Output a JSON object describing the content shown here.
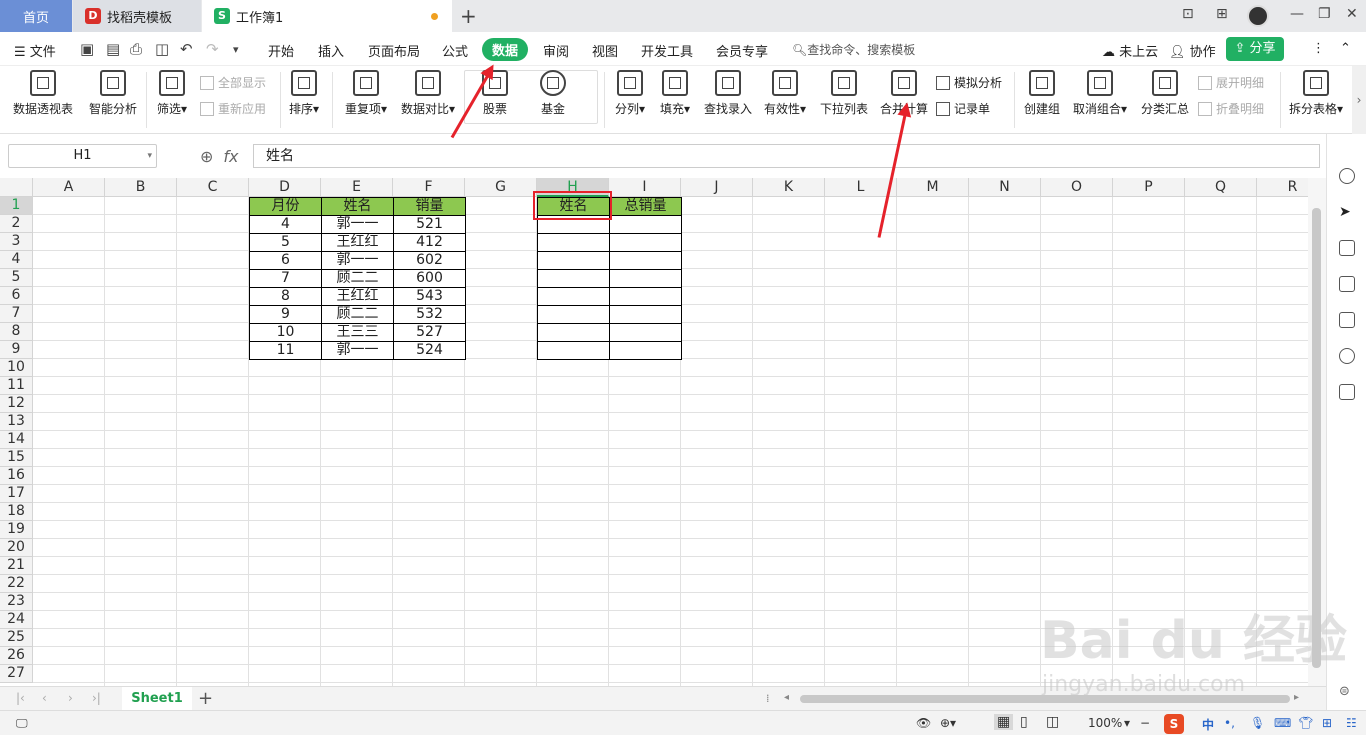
{
  "tabs": {
    "home": "首页",
    "daoke": "找稻壳模板",
    "workbook": "工作簿1"
  },
  "menu": {
    "file": "文件",
    "items": [
      "开始",
      "插入",
      "页面布局",
      "公式",
      "数据",
      "审阅",
      "视图",
      "开发工具",
      "会员专享"
    ],
    "search": "查找命令、搜索模板",
    "cloud": "未上云",
    "collab": "协作",
    "share": "分享"
  },
  "ribbon": {
    "pivot": "数据透视表",
    "smart": "智能分析",
    "filter": "筛选",
    "show_all": "全部显示",
    "reapply": "重新应用",
    "sort": "排序",
    "dup": "重复项",
    "compare": "数据对比",
    "stock": "股票",
    "fund": "基金",
    "split": "分列",
    "fill": "填充",
    "lookup": "查找录入",
    "validity": "有效性",
    "dropdown": "下拉列表",
    "consolidate": "合并计算",
    "simulate": "模拟分析",
    "record": "记录单",
    "group": "创建组",
    "ungroup": "取消组合",
    "subtotal": "分类汇总",
    "expand": "展开明细",
    "collapse": "折叠明细",
    "splittable": "拆分表格"
  },
  "formula": {
    "cell_ref": "H1",
    "fx": "fx",
    "content": "姓名"
  },
  "columns": [
    "A",
    "B",
    "C",
    "D",
    "E",
    "F",
    "G",
    "H",
    "I",
    "J",
    "K",
    "L",
    "M",
    "N",
    "O",
    "P",
    "Q",
    "R"
  ],
  "rows": [
    "1",
    "2",
    "3",
    "4",
    "5",
    "6",
    "7",
    "8",
    "9",
    "10",
    "11",
    "12",
    "13",
    "14",
    "15",
    "16",
    "17",
    "18",
    "19",
    "20",
    "21",
    "22",
    "23",
    "24",
    "25",
    "26",
    "27"
  ],
  "table": {
    "headers": [
      "月份",
      "姓名",
      "销量"
    ],
    "rows": [
      [
        "4",
        "郭一一",
        "521"
      ],
      [
        "5",
        "王红红",
        "412"
      ],
      [
        "6",
        "郭一一",
        "602"
      ],
      [
        "7",
        "顾二二",
        "600"
      ],
      [
        "8",
        "王红红",
        "543"
      ],
      [
        "9",
        "顾二二",
        "532"
      ],
      [
        "10",
        "王三三",
        "527"
      ],
      [
        "11",
        "郭一一",
        "524"
      ]
    ]
  },
  "result": {
    "headers": [
      "姓名",
      "总销量"
    ]
  },
  "sheet_tab": "Sheet1",
  "zoom": "100%",
  "ime": "中",
  "watermark": {
    "main": "Bai du 经验",
    "url": "jingyan.baidu.com"
  },
  "colors": {
    "accent": "#21b063",
    "header_fill": "#8dc850",
    "highlight": "#e5222b"
  }
}
